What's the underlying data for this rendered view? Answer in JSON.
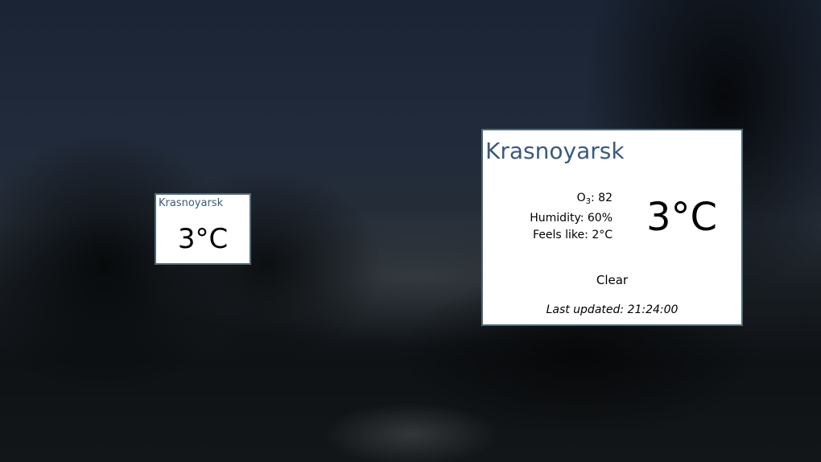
{
  "small_tile": {
    "city": "Krasnoyarsk",
    "temperature": "3°C"
  },
  "large_tile": {
    "city": "Krasnoyarsk",
    "ozone_label": "O",
    "ozone_subscript": "3",
    "ozone_value": ": 82",
    "humidity": "Humidity: 60%",
    "feels_like": "Feels like: 2°C",
    "temperature": "3°C",
    "condition": "Clear",
    "last_updated": "Last updated: 21:24:00"
  },
  "colors": {
    "tile_border": "#4f6a78",
    "city_title": "#3a5a7c"
  }
}
